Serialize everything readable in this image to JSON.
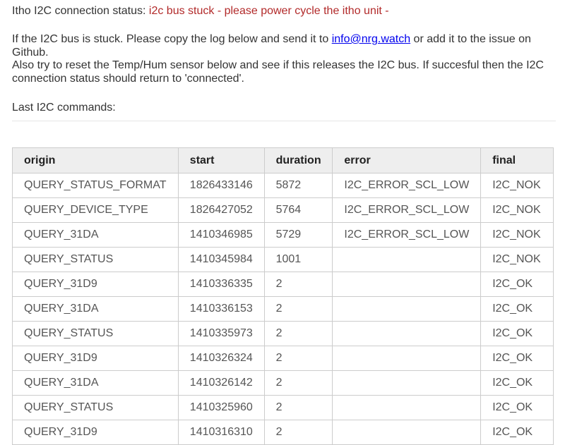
{
  "status": {
    "label": "Itho I2C connection status: ",
    "value": "i2c bus stuck - please power cycle the itho unit -",
    "value_color": "#b22a2a"
  },
  "info": {
    "line1_before": "If the I2C bus is stuck. Please copy the log below and send it to ",
    "email": "info@nrg.watch",
    "line1_after": " or add it to the issue on Github.",
    "line2": "Also try to reset the Temp/Hum sensor below and see if this releases the I2C bus. If succesful then the I2C connection status should return to 'connected'."
  },
  "log_title": "Last I2C commands:",
  "table": {
    "headers": [
      "origin",
      "start",
      "duration",
      "error",
      "final"
    ],
    "rows": [
      [
        "QUERY_STATUS_FORMAT",
        "1826433146",
        "5872",
        "I2C_ERROR_SCL_LOW",
        "I2C_NOK"
      ],
      [
        "QUERY_DEVICE_TYPE",
        "1826427052",
        "5764",
        "I2C_ERROR_SCL_LOW",
        "I2C_NOK"
      ],
      [
        "QUERY_31DA",
        "1410346985",
        "5729",
        "I2C_ERROR_SCL_LOW",
        "I2C_NOK"
      ],
      [
        "QUERY_STATUS",
        "1410345984",
        "1001",
        "",
        "I2C_NOK"
      ],
      [
        "QUERY_31D9",
        "1410336335",
        "2",
        "",
        "I2C_OK"
      ],
      [
        "QUERY_31DA",
        "1410336153",
        "2",
        "",
        "I2C_OK"
      ],
      [
        "QUERY_STATUS",
        "1410335973",
        "2",
        "",
        "I2C_OK"
      ],
      [
        "QUERY_31D9",
        "1410326324",
        "2",
        "",
        "I2C_OK"
      ],
      [
        "QUERY_31DA",
        "1410326142",
        "2",
        "",
        "I2C_OK"
      ],
      [
        "QUERY_STATUS",
        "1410325960",
        "2",
        "",
        "I2C_OK"
      ],
      [
        "QUERY_31D9",
        "1410316310",
        "2",
        "",
        "I2C_OK"
      ]
    ]
  }
}
